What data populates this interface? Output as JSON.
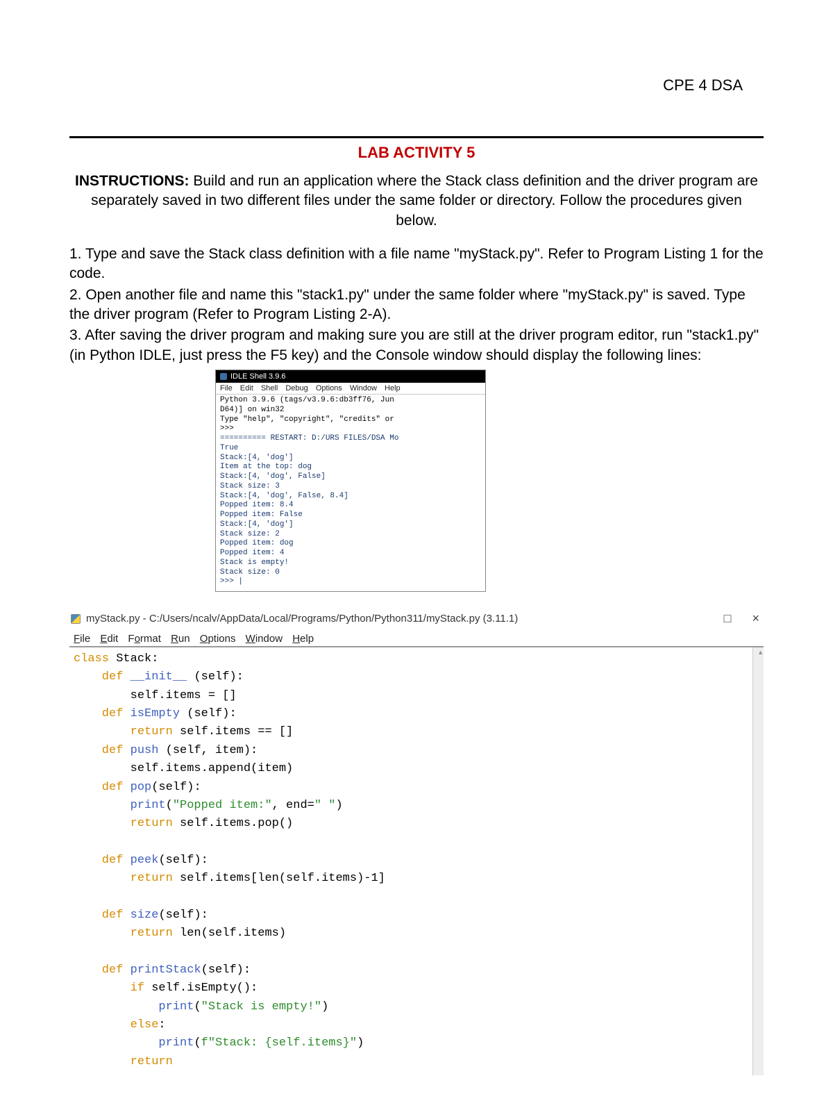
{
  "header": {
    "course": "CPE 4 DSA"
  },
  "title": "LAB ACTIVITY 5",
  "instructions": {
    "label": "INSTRUCTIONS:",
    "text": "Build and run an application where the Stack class definition and the driver program are separately saved in two different files under the same folder or directory. Follow the procedures given below."
  },
  "steps": {
    "s1": "1. Type and save the Stack class definition with a file name \"myStack.py\". Refer to Program Listing 1 for the code.",
    "s2": "2. Open another file and name this \"stack1.py\" under the same folder where \"myStack.py\" is saved. Type the driver program (Refer to Program Listing 2-A).",
    "s3": "3. After saving the driver program and making sure you are still at the driver program editor, run \"stack1.py\" (in Python IDLE, just press the F5 key) and the Console window should display the following lines:"
  },
  "shell": {
    "title": "IDLE Shell 3.9.6",
    "menu": [
      "File",
      "Edit",
      "Shell",
      "Debug",
      "Options",
      "Window",
      "Help"
    ],
    "headerLines": "Python 3.9.6 (tags/v3.9.6:db3ff76, Jun\nD64)] on win32\nType \"help\", \"copyright\", \"credits\" or\n>>>",
    "restart": "========== RESTART: D:/URS FILES/DSA Mo",
    "output": "True\nStack:[4, 'dog']\nItem at the top: dog\nStack:[4, 'dog', False]\nStack size: 3\nStack:[4, 'dog', False, 8.4]\nPopped item: 8.4\nPopped item: False\nStack:[4, 'dog']\nStack size: 2\nPopped item: dog\nPopped item: 4\nStack is empty!\nStack size: 0\n>>> |"
  },
  "editor": {
    "title": "myStack.py - C:/Users/ncalv/AppData/Local/Programs/Python/Python311/myStack.py (3.11.1)",
    "controls": {
      "max": "□",
      "close": "×"
    },
    "menu": {
      "file": "File",
      "edit": "Edit",
      "format": "Format",
      "run": "Run",
      "options": "Options",
      "window": "Window",
      "help": "Help"
    },
    "code": {
      "l1a": "class",
      "l1b": " Stack:",
      "l2a": "    def",
      "l2b": " __init__ ",
      "l2c": "(self):",
      "l3": "        self.items = []",
      "l4a": "    def",
      "l4b": " isEmpty ",
      "l4c": "(self):",
      "l5a": "        return",
      "l5b": " self.items == []",
      "l6a": "    def",
      "l6b": " push ",
      "l6c": "(self, item):",
      "l7": "        self.items.append(item)",
      "l8a": "    def",
      "l8b": " pop",
      "l8c": "(self):",
      "l9a": "        print",
      "l9b": "(",
      "l9c": "\"Popped item:\"",
      "l9d": ", end=",
      "l9e": "\" \"",
      "l9f": ")",
      "l10a": "        return",
      "l10b": " self.items.pop()",
      "blank1": "",
      "l11a": "    def",
      "l11b": " peek",
      "l11c": "(self):",
      "l12a": "        return",
      "l12b": " self.items[len(self.items)-1]",
      "blank2": "",
      "l13a": "    def",
      "l13b": " size",
      "l13c": "(self):",
      "l14a": "        return",
      "l14b": " len(self.items)",
      "blank3": "",
      "l15a": "    def",
      "l15b": " printStack",
      "l15c": "(self):",
      "l16a": "        if",
      "l16b": " self.isEmpty():",
      "l17a": "            print",
      "l17b": "(",
      "l17c": "\"Stack is empty!\"",
      "l17d": ")",
      "l18a": "        else",
      "l18b": ":",
      "l19a": "            print",
      "l19b": "(",
      "l19c": "f\"Stack: {self.items}\"",
      "l19d": ")",
      "l20a": "        return"
    }
  }
}
